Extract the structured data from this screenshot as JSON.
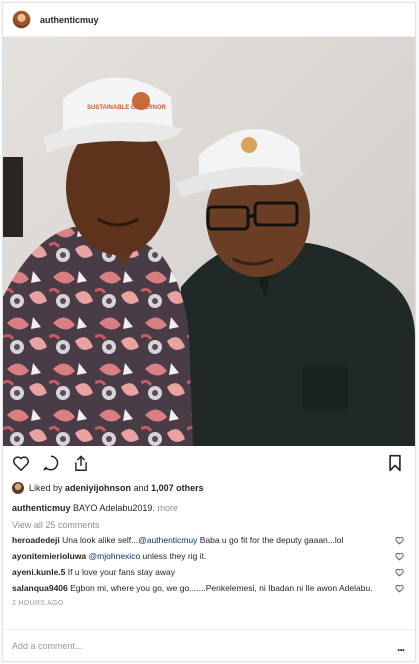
{
  "post": {
    "username": "authenticmuy",
    "cap_text": "SUSTAINABLE GOVERNOR",
    "likes": {
      "prefix": "Liked by",
      "liker": "adeniyijohnson",
      "connector": "and",
      "others": "1,007 others"
    },
    "caption": {
      "username": "authenticmuy",
      "text": "BAYO Adelabu2019.",
      "more": "more"
    },
    "view_all": "View all 25 comments",
    "comments": [
      {
        "username": "heroadedeji",
        "text_before": "Una look alike self...",
        "mention": "@authenticmuy",
        "text_after": " Baba u go fit for the deputy gaaan...lol"
      },
      {
        "username": "ayonitemierioluwa",
        "text_before": "",
        "mention": "@mjohnexico",
        "text_after": " unless they rig it."
      },
      {
        "username": "ayeni.kunle.5",
        "text_before": "If u love your fans stay away",
        "mention": "",
        "text_after": ""
      },
      {
        "username": "salanqua9406",
        "text_before": "Egbon mi, where you go, we go.......Penkelemesi, ni Ibadan ni Ile awon Adelabu.",
        "mention": "",
        "text_after": ""
      }
    ],
    "timestamp": "2 HOURS AGO",
    "add_comment_placeholder": "Add a comment...",
    "more_options": "..."
  },
  "icons": [
    "heart-icon",
    "comment-icon",
    "share-icon",
    "bookmark-icon",
    "more-icon"
  ]
}
